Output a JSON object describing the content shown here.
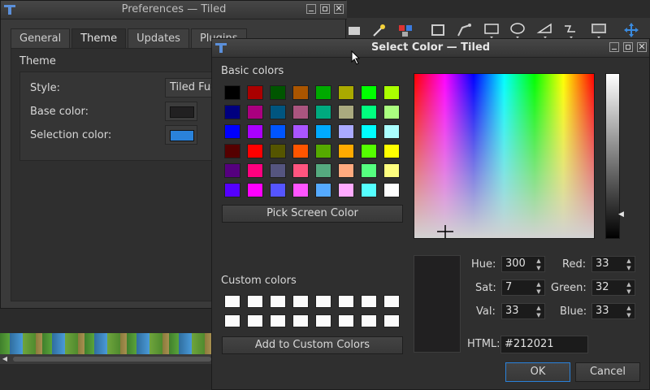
{
  "app_toolbar": {
    "icons": [
      "stamp-brush-icon",
      "magic-wand-icon",
      "select-same-tile-icon",
      "insert-tile-icon",
      "insert-polygon-icon",
      "insert-rectangle-icon",
      "insert-ellipse-icon",
      "insert-polyline-icon",
      "insert-text-icon",
      "insert-template-icon",
      "move-tool-icon"
    ]
  },
  "preferences": {
    "title": "Preferences — Tiled",
    "tabs": [
      {
        "label": "General"
      },
      {
        "label": "Theme"
      },
      {
        "label": "Updates"
      },
      {
        "label": "Plugins"
      }
    ],
    "active_tab": "Theme",
    "group_title": "Theme",
    "style_label": "Style:",
    "style_value": "Tiled Fus",
    "base_color_label": "Base color:",
    "base_color_value": "#212021",
    "selection_color_label": "Selection color:",
    "selection_color_value": "#2a82da"
  },
  "color_dialog": {
    "title": "Select Color — Tiled",
    "basic_colors_label": "Basic colors",
    "basic_colors_mnemonic": "B",
    "basic_colors": [
      [
        "#000000",
        "#aa0000",
        "#005500",
        "#aa5500",
        "#00aa00",
        "#aaaa00",
        "#00ff00",
        "#aaff00"
      ],
      [
        "#00007f",
        "#aa007f",
        "#00557f",
        "#aa557f",
        "#00aa7f",
        "#aaaa7f",
        "#00ff7f",
        "#aaff7f"
      ],
      [
        "#0000ff",
        "#aa00ff",
        "#0055ff",
        "#aa55ff",
        "#00aaff",
        "#aaaaff",
        "#00ffff",
        "#aaffff"
      ],
      [
        "#550000",
        "#ff0000",
        "#555500",
        "#ff5500",
        "#55aa00",
        "#ffaa00",
        "#55ff00",
        "#ffff00"
      ],
      [
        "#55007f",
        "#ff007f",
        "#55557f",
        "#ff557f",
        "#55aa7f",
        "#ffaa7f",
        "#55ff7f",
        "#ffff7f"
      ],
      [
        "#5500ff",
        "#ff00ff",
        "#5555ff",
        "#ff55ff",
        "#55aaff",
        "#ffaaff",
        "#55ffff",
        "#ffffff"
      ]
    ],
    "pick_screen_label": "Pick Screen Color",
    "custom_colors_label": "Custom colors",
    "custom_colors": [
      "#fbfbfb",
      "#fbfbfb",
      "#fbfbfb",
      "#fbfbfb",
      "#fbfbfb",
      "#fbfbfb",
      "#fbfbfb",
      "#fbfbfb",
      "#fbfbfb",
      "#fbfbfb",
      "#fbfbfb",
      "#fbfbfb",
      "#fbfbfb",
      "#fbfbfb",
      "#fbfbfb",
      "#fbfbfb"
    ],
    "add_custom_label": "Add to Custom Colors",
    "hue_label": "Hue:",
    "hue": "300",
    "sat_label": "Sat:",
    "sat": "7",
    "val_label": "Val:",
    "val": "33",
    "red_label": "Red:",
    "red": "33",
    "green_label": "Green:",
    "green": "32",
    "blue_label": "Blue:",
    "blue": "33",
    "html_label": "HTML:",
    "html": "#212021",
    "current_color": "#212021",
    "ok_label": "OK",
    "cancel_label": "Cancel"
  }
}
